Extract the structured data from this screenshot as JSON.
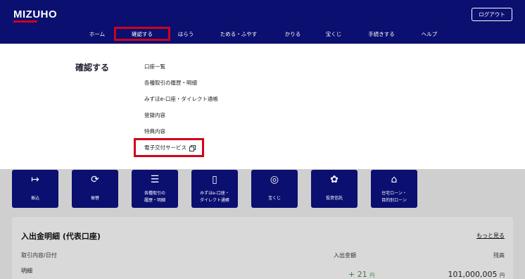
{
  "header": {
    "brand": "MIZUHO",
    "logout_label": "ログアウト",
    "nav": [
      {
        "label": "ホーム"
      },
      {
        "label": "確認する"
      },
      {
        "label": "はらう"
      },
      {
        "label": "ためる・ふやす"
      },
      {
        "label": "かりる"
      },
      {
        "label": "宝くじ"
      },
      {
        "label": "手続きする"
      },
      {
        "label": "ヘルプ"
      }
    ]
  },
  "dropdown": {
    "title": "確認する",
    "links": [
      {
        "label": "口座一覧"
      },
      {
        "label": "各種取引の履歴・明細"
      },
      {
        "label": "みずほe-口座・ダイレクト通帳"
      },
      {
        "label": "登録内容"
      },
      {
        "label": "特典内容"
      },
      {
        "label": "電子交付サービス"
      }
    ]
  },
  "tiles": [
    {
      "icon": "↦",
      "line1": "振込",
      "line2": ""
    },
    {
      "icon": "⟳",
      "line1": "振替",
      "line2": ""
    },
    {
      "icon": "☰",
      "line1": "各種取引の",
      "line2": "履歴・明細"
    },
    {
      "icon": "▯",
      "line1": "みずほe-口座・",
      "line2": "ダイレクト通帳"
    },
    {
      "icon": "◎",
      "line1": "宝くじ",
      "line2": ""
    },
    {
      "icon": "✿",
      "line1": "投資信託",
      "line2": ""
    },
    {
      "icon": "⌂",
      "line1": "住宅ローン・",
      "line2": "目的別ローン"
    }
  ],
  "statement": {
    "title": "入出金明細 (代表口座)",
    "more": "もっと見る",
    "col_detail": "取引内容/日付",
    "col_amount": "入出金額",
    "col_balance": "残高",
    "row_label": "明細",
    "amount": "+ 21",
    "balance": "101,000,005",
    "yen": "円"
  }
}
